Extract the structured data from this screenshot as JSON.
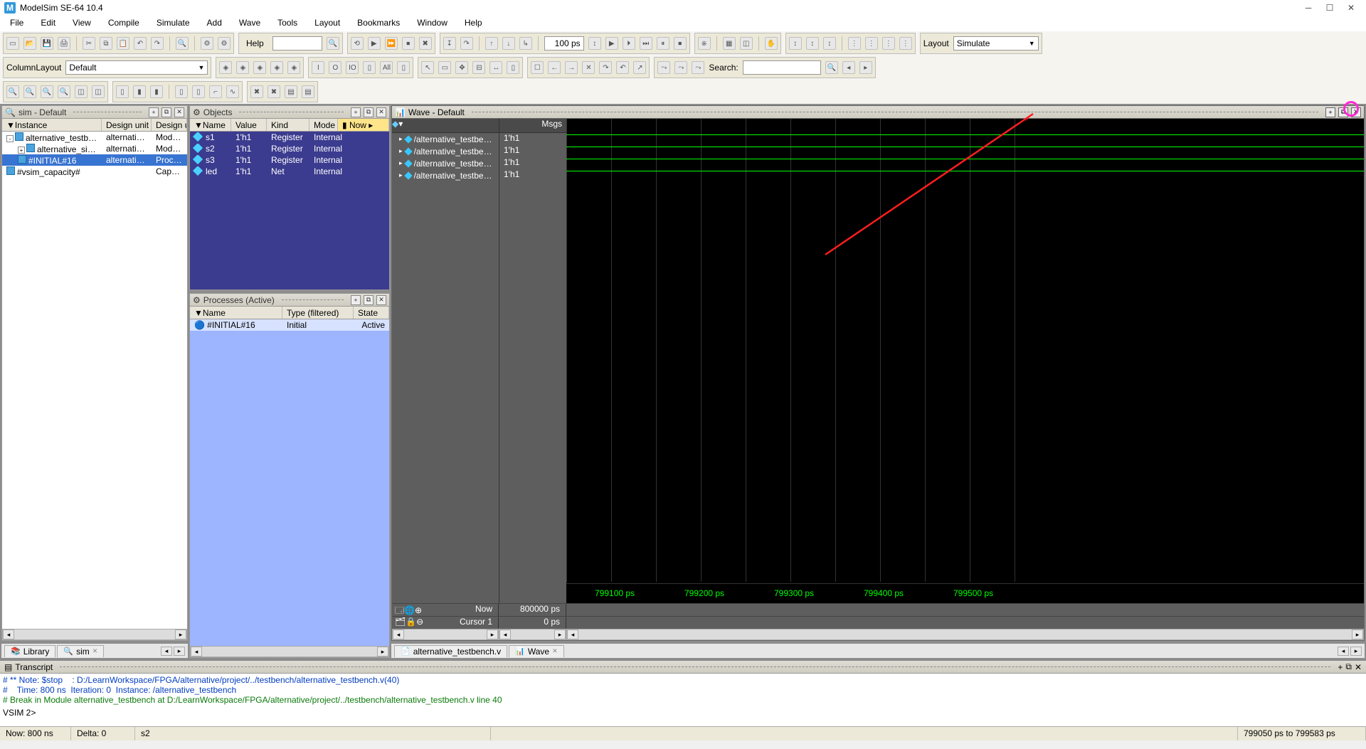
{
  "title": "ModelSim SE-64 10.4",
  "menu": [
    "File",
    "Edit",
    "View",
    "Compile",
    "Simulate",
    "Add",
    "Wave",
    "Tools",
    "Layout",
    "Bookmarks",
    "Window",
    "Help"
  ],
  "help_label": "Help",
  "time_field": "100 ps",
  "layout_label": "Layout",
  "layout_value": "Simulate",
  "column_layout_label": "ColumnLayout",
  "column_layout_value": "Default",
  "search_label": "Search:",
  "sim_panel": {
    "title": "sim - Default",
    "cols": [
      "Instance",
      "Design unit",
      "Design un"
    ],
    "rows": [
      {
        "indent": 0,
        "exp": "-",
        "name": "alternative_testbe…",
        "du": "alternative…",
        "kind": "Module",
        "sel": false
      },
      {
        "indent": 1,
        "exp": "+",
        "name": "alternative_sim…",
        "du": "alternative…",
        "kind": "Module",
        "sel": false
      },
      {
        "indent": 1,
        "exp": "",
        "name": "#INITIAL#16",
        "du": "alternative…",
        "kind": "Process",
        "sel": true
      },
      {
        "indent": 0,
        "exp": "",
        "name": "#vsim_capacity#",
        "du": "",
        "kind": "Capacity",
        "sel": false
      }
    ],
    "tabs": [
      "Library",
      "sim"
    ]
  },
  "objects_panel": {
    "title": "Objects",
    "cols": [
      "Name",
      "Value",
      "Kind",
      "Mode"
    ],
    "now_label": "Now",
    "rows": [
      {
        "name": "s1",
        "value": "1'h1",
        "kind": "Register",
        "mode": "Internal"
      },
      {
        "name": "s2",
        "value": "1'h1",
        "kind": "Register",
        "mode": "Internal"
      },
      {
        "name": "s3",
        "value": "1'h1",
        "kind": "Register",
        "mode": "Internal"
      },
      {
        "name": "led",
        "value": "1'h1",
        "kind": "Net",
        "mode": "Internal"
      }
    ]
  },
  "processes_panel": {
    "title": "Processes (Active)",
    "cols": [
      "Name",
      "Type (filtered)",
      "State"
    ],
    "rows": [
      {
        "name": "#INITIAL#16",
        "type": "Initial",
        "state": "Active"
      }
    ]
  },
  "wave_panel": {
    "title": "Wave - Default",
    "msgs_label": "Msgs",
    "signals": [
      {
        "name": "/alternative_testbe…",
        "val": "1'h1"
      },
      {
        "name": "/alternative_testbe…",
        "val": "1'h1"
      },
      {
        "name": "/alternative_testbe…",
        "val": "1'h1"
      },
      {
        "name": "/alternative_testbe…",
        "val": "1'h1"
      }
    ],
    "now_label": "Now",
    "now_value": "800000 ps",
    "cursor_label": "Cursor 1",
    "cursor_value": "0 ps",
    "time_labels": [
      "799100 ps",
      "799200 ps",
      "799300 ps",
      "799400 ps",
      "799500 ps"
    ],
    "tabs": [
      "alternative_testbench.v",
      "Wave"
    ]
  },
  "transcript": {
    "title": "Transcript",
    "lines": [
      {
        "cls": "t-blue",
        "text": "# ** Note: $stop    : D:/LearnWorkspace/FPGA/alternative/project/../testbench/alternative_testbench.v(40)"
      },
      {
        "cls": "t-blue",
        "text": "#    Time: 800 ns  Iteration: 0  Instance: /alternative_testbench"
      },
      {
        "cls": "t-green",
        "text": "# Break in Module alternative_testbench at D:/LearnWorkspace/FPGA/alternative/project/../testbench/alternative_testbench.v line 40"
      }
    ],
    "prompt": "VSIM 2>"
  },
  "statusbar": {
    "now": "Now: 800 ns",
    "delta": "Delta: 0",
    "hover": "s2",
    "range": "799050 ps to 799583 ps"
  }
}
